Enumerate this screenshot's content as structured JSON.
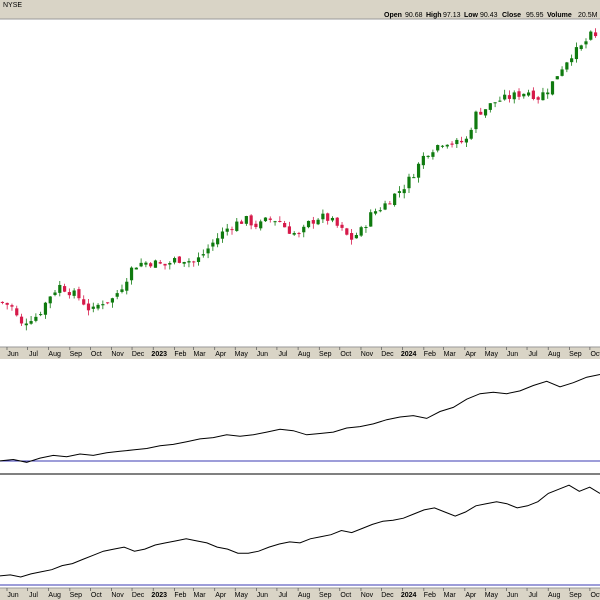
{
  "header": {
    "exchange": "NYSE",
    "open_label": "Open",
    "open_value": "90.68",
    "high_label": "High",
    "high_value": "97.13",
    "low_label": "Low",
    "low_value": "90.43",
    "close_label": "Close",
    "close_value": "95.95",
    "volume_label": "Volume",
    "volume_value": "20.5M"
  },
  "colors": {
    "up": "#0f7a0f",
    "down": "#d61a4a",
    "line": "#000000",
    "baseline": "#3b3bb3",
    "header_bg": "#d9d4c6",
    "axis_bg": "#d9d4c6"
  },
  "chart_data": [
    {
      "type": "candlestick",
      "title": "",
      "x_ticks": [
        "Jun",
        "Jul",
        "Aug",
        "Sep",
        "Oct",
        "Nov",
        "Dec",
        "2023",
        "Feb",
        "Mar",
        "Apr",
        "May",
        "Jun",
        "Jul",
        "Aug",
        "Sep",
        "Oct",
        "Nov",
        "Dec",
        "2024",
        "Feb",
        "Mar",
        "Apr",
        "May",
        "Jun",
        "Jul",
        "Aug",
        "Sep",
        "Oct"
      ],
      "bold_ticks": [
        "2023",
        "2024"
      ],
      "close_path": [
        [
          "2022-05-20",
          33
        ],
        [
          "2022-06-05",
          32
        ],
        [
          "2022-06-20",
          26
        ],
        [
          "2022-07-01",
          28
        ],
        [
          "2022-07-15",
          29
        ],
        [
          "2022-08-01",
          35
        ],
        [
          "2022-08-15",
          38
        ],
        [
          "2022-09-01",
          36
        ],
        [
          "2022-09-15",
          34
        ],
        [
          "2022-10-01",
          30
        ],
        [
          "2022-10-15",
          33
        ],
        [
          "2022-11-01",
          34
        ],
        [
          "2022-11-15",
          38
        ],
        [
          "2022-12-01",
          44
        ],
        [
          "2022-12-15",
          45
        ],
        [
          "2023-01-01",
          45
        ],
        [
          "2023-01-15",
          44
        ],
        [
          "2023-02-01",
          46
        ],
        [
          "2023-02-15",
          46
        ],
        [
          "2023-03-01",
          45
        ],
        [
          "2023-03-15",
          48
        ],
        [
          "2023-04-01",
          52
        ],
        [
          "2023-04-15",
          55
        ],
        [
          "2023-05-01",
          57
        ],
        [
          "2023-05-15",
          58
        ],
        [
          "2023-06-01",
          56
        ],
        [
          "2023-06-15",
          58
        ],
        [
          "2023-07-01",
          58
        ],
        [
          "2023-07-15",
          55
        ],
        [
          "2023-08-01",
          53
        ],
        [
          "2023-08-15",
          57
        ],
        [
          "2023-09-01",
          59
        ],
        [
          "2023-09-15",
          58
        ],
        [
          "2023-10-01",
          55
        ],
        [
          "2023-10-15",
          52
        ],
        [
          "2023-11-01",
          55
        ],
        [
          "2023-11-15",
          60
        ],
        [
          "2023-12-01",
          62
        ],
        [
          "2023-12-15",
          65
        ],
        [
          "2024-01-01",
          68
        ],
        [
          "2024-01-15",
          72
        ],
        [
          "2024-02-01",
          78
        ],
        [
          "2024-02-15",
          80
        ],
        [
          "2024-03-01",
          82
        ],
        [
          "2024-03-15",
          81
        ],
        [
          "2024-04-01",
          82
        ],
        [
          "2024-04-15",
          90
        ],
        [
          "2024-05-01",
          92
        ],
        [
          "2024-05-15",
          94
        ],
        [
          "2024-06-01",
          95
        ],
        [
          "2024-06-15",
          96
        ],
        [
          "2024-07-01",
          97
        ],
        [
          "2024-07-15",
          95
        ],
        [
          "2024-08-01",
          98
        ],
        [
          "2024-08-15",
          103
        ],
        [
          "2024-09-01",
          108
        ],
        [
          "2024-09-15",
          110
        ],
        [
          "2024-10-01",
          114
        ],
        [
          "2024-10-10",
          113
        ]
      ]
    },
    {
      "type": "line",
      "title": "",
      "values": [
        3,
        4,
        2,
        5,
        7,
        6,
        8,
        7,
        9,
        10,
        11,
        12,
        14,
        15,
        17,
        19,
        20,
        22,
        21,
        22,
        24,
        26,
        25,
        22,
        23,
        24,
        27,
        28,
        30,
        33,
        35,
        36,
        34,
        39,
        42,
        48,
        52,
        53,
        52,
        54,
        58,
        61,
        57,
        60,
        64,
        66
      ]
    },
    {
      "type": "line",
      "title": "",
      "values": [
        2,
        3,
        1,
        4,
        6,
        8,
        12,
        14,
        18,
        22,
        26,
        28,
        30,
        26,
        28,
        32,
        34,
        36,
        38,
        36,
        34,
        30,
        28,
        24,
        24,
        26,
        30,
        33,
        35,
        34,
        38,
        40,
        42,
        46,
        44,
        48,
        52,
        55,
        56,
        58,
        62,
        66,
        68,
        64,
        60,
        64,
        70,
        72,
        74,
        72,
        68,
        70,
        74,
        82,
        86,
        90,
        84,
        88,
        82
      ]
    }
  ]
}
